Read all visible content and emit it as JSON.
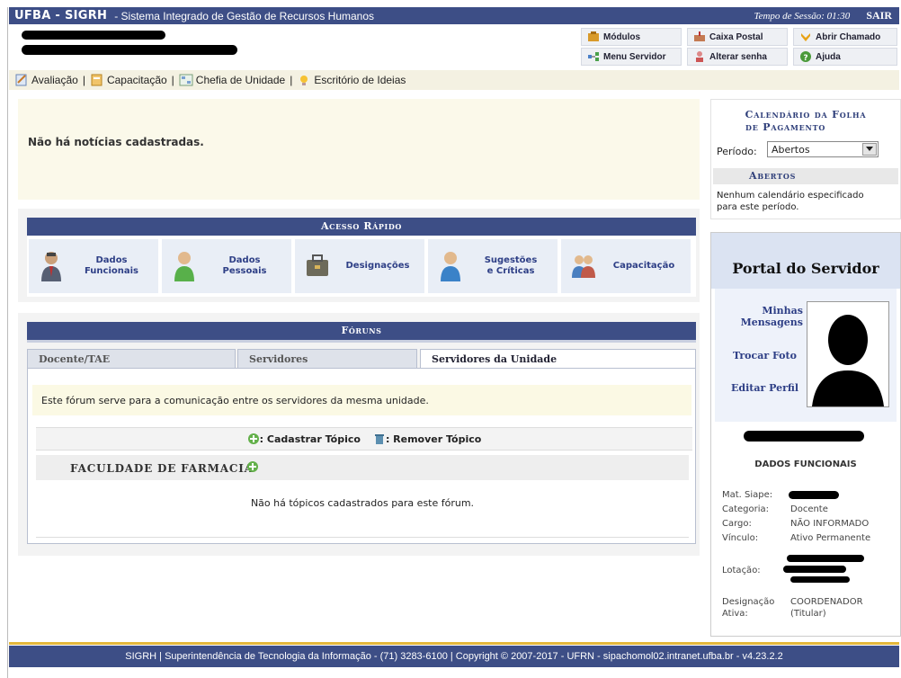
{
  "topbar": {
    "brand": "UFBA - SIGRH",
    "subtitle": "- Sistema Integrado de Gestão de Recursos Humanos",
    "session": "Tempo de Sessão: 01:30",
    "logout": "SAIR"
  },
  "header_links": {
    "modulos": "Módulos",
    "caixa_postal": "Caixa Postal",
    "abrir_chamado": "Abrir Chamado",
    "menu_servidor": "Menu Servidor",
    "alterar_senha": "Alterar senha",
    "ajuda": "Ajuda"
  },
  "menu": {
    "avaliacao": "Avaliação",
    "capacitacao": "Capacitação",
    "chefia": "Chefia de Unidade",
    "escritorio": "Escritório de Ideias",
    "separator": "|"
  },
  "noticias": "Não há notícias cadastradas.",
  "acesso_rapido": {
    "title": "Acesso Rápido",
    "items": [
      {
        "l1": "Dados",
        "l2": "Funcionais"
      },
      {
        "l1": "Dados",
        "l2": "Pessoais"
      },
      {
        "l1": "Designações",
        "l2": ""
      },
      {
        "l1": "Sugestões",
        "l2": "e Críticas"
      },
      {
        "l1": "Capacitação",
        "l2": ""
      }
    ]
  },
  "foruns": {
    "title": "Fóruns",
    "tabs": [
      "Docente/TAE",
      "Servidores",
      "Servidores da Unidade"
    ],
    "description": "Este fórum serve para a comunicação entre os servidores da mesma unidade.",
    "cadastrar": ": Cadastrar Tópico",
    "remover": ": Remover Tópico",
    "unidade": "FACULDADE DE FARMACIA",
    "empty": "Não há tópicos cadastrados para este fórum."
  },
  "calendario": {
    "title_l1": "Calendário da Folha",
    "title_l2": "de Pagamento",
    "periodo_label": "Período:",
    "periodo_value": "Abertos",
    "section": "Abertos",
    "empty_l1": "Nenhum calendário especificado",
    "empty_l2": "para este período."
  },
  "portal": {
    "title": "Portal do Servidor",
    "minhas_l1": "Minhas",
    "minhas_l2": "Mensagens",
    "trocar_foto": "Trocar Foto",
    "editar_perfil": "Editar Perfil",
    "dados_funcionais": "DADOS FUNCIONAIS",
    "mat_label": "Mat. Siape:",
    "categoria_label": "Categoria:",
    "categoria_value": "Docente",
    "cargo_label": "Cargo:",
    "cargo_value": "NÃO INFORMADO",
    "vinculo_label": "Vínculo:",
    "vinculo_value": "Ativo Permanente",
    "lotacao_label": "Lotação:",
    "designacao_l1": "Designação",
    "designacao_l2": "Ativa:",
    "designacao_value_l1": "COORDENADOR",
    "designacao_value_l2": "(Titular)"
  },
  "footer": "SIGRH | Superintendência de Tecnologia da Informação - (71) 3283-6100 | Copyright © 2007-2017 - UFRN - sipachomol02.intranet.ufba.br - v4.23.2.2"
}
